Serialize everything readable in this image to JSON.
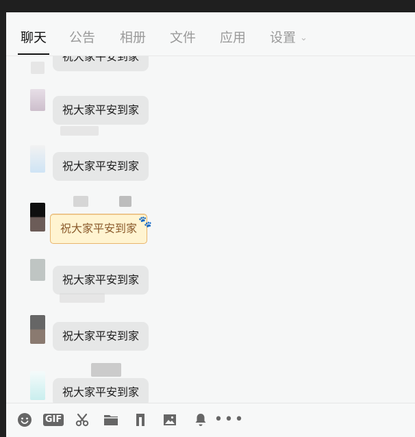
{
  "tabs": {
    "chat": "聊天",
    "notice": "公告",
    "album": "相册",
    "files": "文件",
    "apps": "应用",
    "settings": "设置"
  },
  "chat": {
    "messages": [
      {
        "text": "祝大家平安到家",
        "bubble_style": "normal"
      },
      {
        "text": "祝大家平安到家",
        "bubble_style": "normal"
      },
      {
        "text": "祝大家平安到家",
        "bubble_style": "special"
      },
      {
        "text": "祝大家平安到家",
        "bubble_style": "normal"
      },
      {
        "text": "祝大家平安到家",
        "bubble_style": "normal"
      },
      {
        "text": "祝大家平安到家",
        "bubble_style": "normal"
      },
      {
        "text": "祝大家平安到家",
        "bubble_style": "normal"
      }
    ]
  },
  "toolbar": {
    "gif_label": "GIF",
    "icons": [
      "emoji-icon",
      "gif-icon",
      "scissors-icon",
      "folder-icon",
      "music-icon",
      "image-icon",
      "bell-icon",
      "more-icon"
    ]
  },
  "colors": {
    "window_background": "#f6f7f7",
    "bubble_background": "#e6e7e7",
    "special_bubble_background": "#fff4d1",
    "special_bubble_border": "#e9b56b",
    "tab_active": "#111111",
    "tab_inactive": "#9a9a9a"
  }
}
